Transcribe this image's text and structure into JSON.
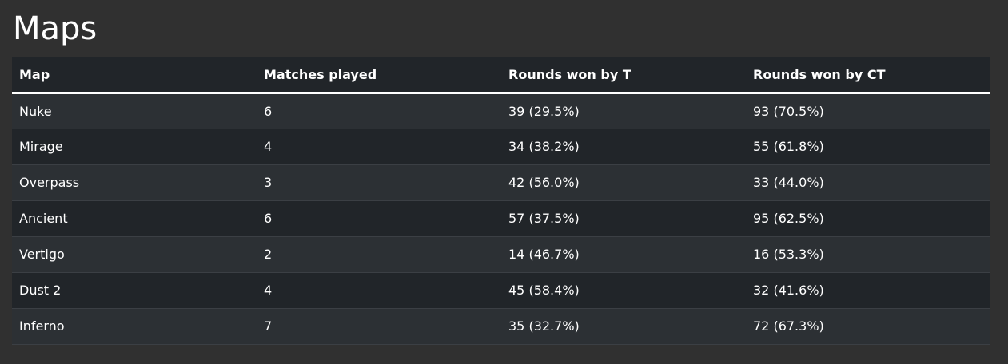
{
  "page": {
    "title": "Maps"
  },
  "table": {
    "headers": {
      "map": "Map",
      "matches": "Matches played",
      "t_rounds": "Rounds won by T",
      "ct_rounds": "Rounds won by CT"
    },
    "rows": [
      {
        "map": "Nuke",
        "matches": "6",
        "t_rounds": "39 (29.5%)",
        "ct_rounds": "93 (70.5%)"
      },
      {
        "map": "Mirage",
        "matches": "4",
        "t_rounds": "34 (38.2%)",
        "ct_rounds": "55 (61.8%)"
      },
      {
        "map": "Overpass",
        "matches": "3",
        "t_rounds": "42 (56.0%)",
        "ct_rounds": "33 (44.0%)"
      },
      {
        "map": "Ancient",
        "matches": "6",
        "t_rounds": "57 (37.5%)",
        "ct_rounds": "95 (62.5%)"
      },
      {
        "map": "Vertigo",
        "matches": "2",
        "t_rounds": "14 (46.7%)",
        "ct_rounds": "16 (53.3%)"
      },
      {
        "map": "Dust 2",
        "matches": "4",
        "t_rounds": "45 (58.4%)",
        "ct_rounds": "32 (41.6%)"
      },
      {
        "map": "Inferno",
        "matches": "7",
        "t_rounds": "35 (32.7%)",
        "ct_rounds": "72 (67.3%)"
      }
    ]
  },
  "colors": {
    "page_background": "#303030",
    "header_background": "#212529",
    "row_odd": "#2c3034",
    "row_even": "#212529",
    "text": "#ffffff"
  }
}
